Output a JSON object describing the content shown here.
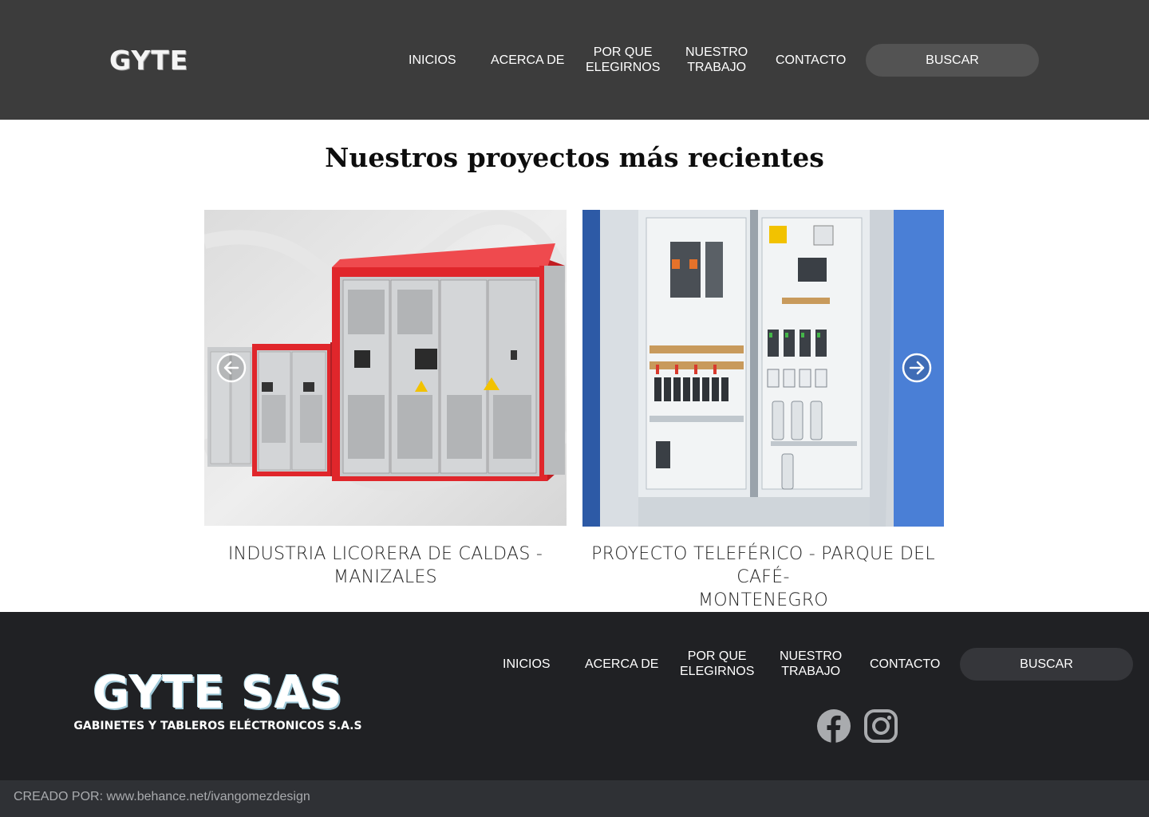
{
  "header": {
    "logo": "GYTE",
    "nav": [
      {
        "label": "INICIOS"
      },
      {
        "label": "ACERCA DE"
      },
      {
        "label": "POR QUE\nELEGIRNOS"
      },
      {
        "label": "NUESTRO\nTRABAJO"
      },
      {
        "label": "CONTACTO"
      }
    ],
    "search_label": "BUSCAR"
  },
  "main": {
    "title": "Nuestros proyectos más recientes",
    "projects": [
      {
        "caption": "INDUSTRIA LICORERA DE CALDAS - MANIZALES"
      },
      {
        "caption": "PROYECTO TELEFÉRICO - PARQUE DEL CAFÉ-\nMONTENEGRO"
      }
    ],
    "prev_icon": "arrow-left-circle-icon",
    "next_icon": "arrow-right-circle-icon"
  },
  "footer": {
    "logo_main": "GYTE SAS",
    "logo_sub": "GABINETES Y TABLEROS ELÉCTRONICOS S.A.S",
    "nav": [
      {
        "label": "INICIOS"
      },
      {
        "label": "ACERCA DE"
      },
      {
        "label": "POR QUE\nELEGIRNOS"
      },
      {
        "label": "NUESTRO\nTRABAJO"
      },
      {
        "label": "CONTACTO"
      }
    ],
    "search_label": "BUSCAR",
    "social": [
      "facebook-icon",
      "instagram-icon"
    ],
    "credit": "CREADO POR: www.behance.net/ivangomezdesign"
  },
  "colors": {
    "header_bg": "#3c3c3c",
    "header_button": "#535353",
    "footer_bg": "#202124",
    "footer_button": "#35363a",
    "credit_bar": "#2f3135",
    "cabinet_red": "#e0262b"
  }
}
